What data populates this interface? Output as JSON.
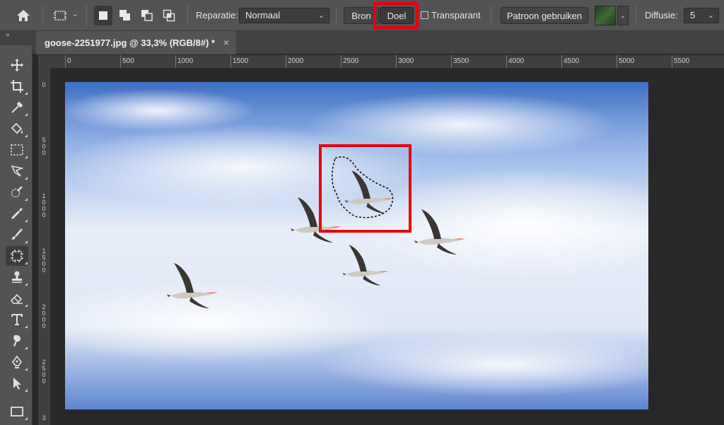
{
  "options_bar": {
    "home_icon": "home-icon",
    "patch_tool_icon": "patch-tool-icon",
    "mode_icons": [
      "new-selection-icon",
      "add-to-selection-icon",
      "subtract-from-selection-icon",
      "intersect-selection-icon"
    ],
    "repair_label": "Reparatie:",
    "repair_value": "Normaal",
    "source_label": "Bron",
    "target_label": "Doel",
    "transparent_label": "Transparant",
    "use_pattern_label": "Patroon gebruiken",
    "diffusion_label": "Diffusie:",
    "diffusion_value": "5",
    "highlight_color": "#e6000d"
  },
  "tabs": {
    "collapse_label": "»",
    "document_title": "goose-2251977.jpg @ 33,3% (RGB/8#) *",
    "close_label": "×"
  },
  "ruler": {
    "horizontal": [
      "0",
      "500",
      "1000",
      "1500",
      "2000",
      "2500",
      "3000",
      "3500",
      "4000",
      "4500",
      "5000",
      "5500"
    ],
    "vertical": [
      "0",
      "500",
      "1000",
      "1500",
      "2000",
      "2500",
      "3"
    ]
  },
  "tools": [
    {
      "name": "move-tool",
      "icon": "move-icon"
    },
    {
      "name": "crop-tool",
      "icon": "crop-icon"
    },
    {
      "name": "eyedropper-tool",
      "icon": "eyedropper-icon"
    },
    {
      "name": "paint-bucket-tool",
      "icon": "paint-bucket-icon"
    },
    {
      "name": "marquee-tool",
      "icon": "marquee-icon"
    },
    {
      "name": "lasso-tool",
      "icon": "lasso-icon"
    },
    {
      "name": "quick-selection-tool",
      "icon": "quick-selection-icon"
    },
    {
      "name": "healing-brush-tool",
      "icon": "healing-brush-icon"
    },
    {
      "name": "brush-tool",
      "icon": "brush-icon"
    },
    {
      "name": "patch-tool",
      "icon": "patch-icon",
      "active": true
    },
    {
      "name": "clone-stamp-tool",
      "icon": "stamp-icon"
    },
    {
      "name": "eraser-tool",
      "icon": "eraser-icon"
    },
    {
      "name": "type-tool",
      "icon": "type-icon"
    },
    {
      "name": "smudge-tool",
      "icon": "smudge-icon"
    },
    {
      "name": "pen-tool",
      "icon": "pen-icon"
    },
    {
      "name": "path-selection-tool",
      "icon": "arrow-icon"
    },
    {
      "name": "rectangle-tool",
      "icon": "rectangle-icon"
    }
  ],
  "colors": {
    "panel": "#535353",
    "canvas_bg": "#282828",
    "sky_top": "#3f6fc4",
    "sky_mid": "#e6ecf7",
    "highlight": "#e6000d"
  }
}
